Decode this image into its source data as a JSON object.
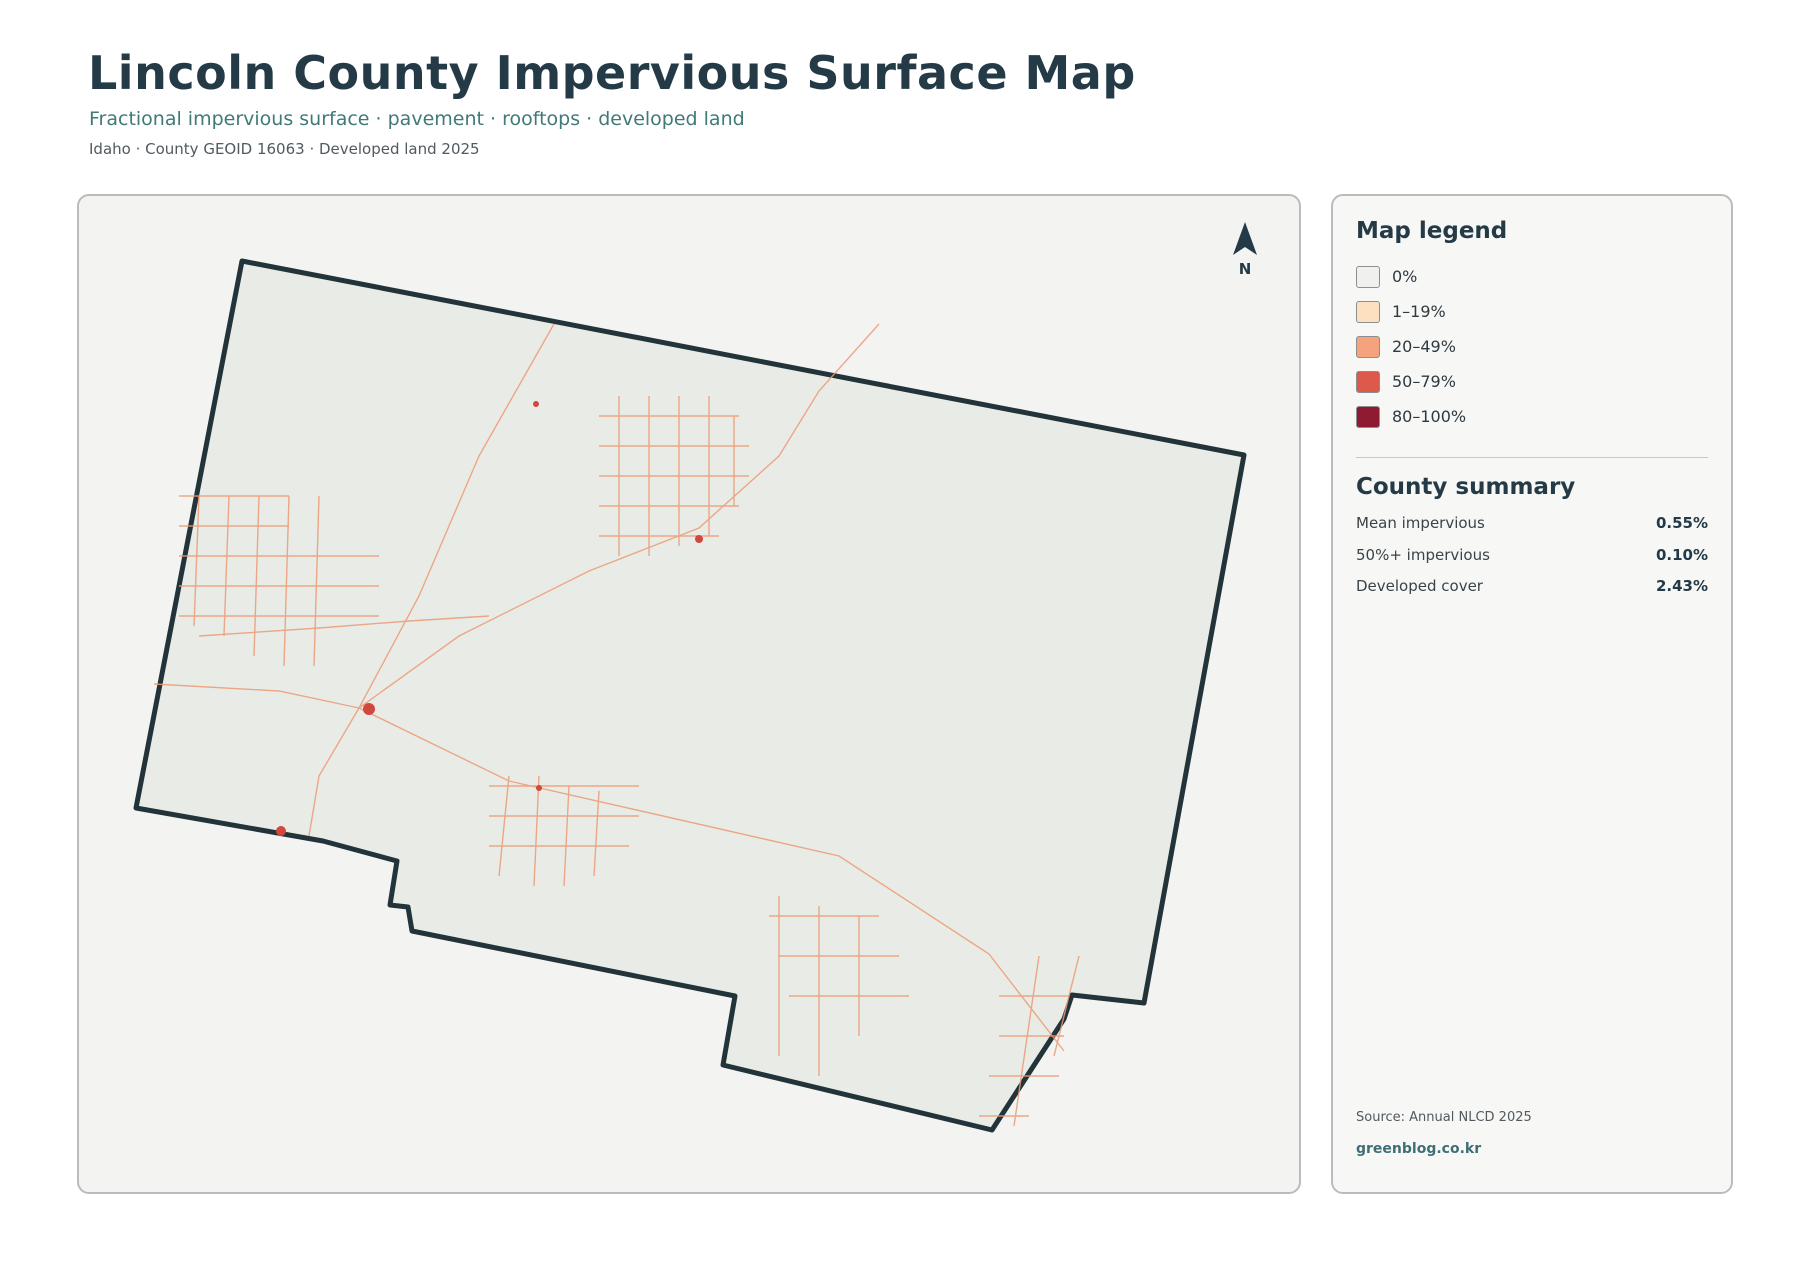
{
  "header": {
    "title": "Lincoln County Impervious Surface Map",
    "subtitle": "Fractional impervious surface · pavement · rooftops · developed land",
    "meta": "Idaho · County GEOID 16063 · Developed land 2025"
  },
  "north_arrow": {
    "label": "N"
  },
  "legend": {
    "title": "Map legend",
    "items": [
      {
        "label": "0%",
        "color": "#f0f0ee"
      },
      {
        "label": "1–19%",
        "color": "#fde0c0"
      },
      {
        "label": "20–49%",
        "color": "#f4a37c"
      },
      {
        "label": "50–79%",
        "color": "#dd5a4a"
      },
      {
        "label": "80–100%",
        "color": "#8e1b32"
      }
    ]
  },
  "summary": {
    "title": "County summary",
    "rows": [
      {
        "label": "Mean impervious",
        "value": "0.55%"
      },
      {
        "label": "50%+ impervious",
        "value": "0.10%"
      },
      {
        "label": "Developed cover",
        "value": "2.43%"
      }
    ]
  },
  "footer": {
    "source": "Source: Annual NLCD 2025",
    "credit": "greenblog.co.kr"
  },
  "colors": {
    "county_fill": "#e9ece6",
    "county_outline": "#22333a",
    "road": "#ec9a75",
    "urban": "#d0483e"
  }
}
